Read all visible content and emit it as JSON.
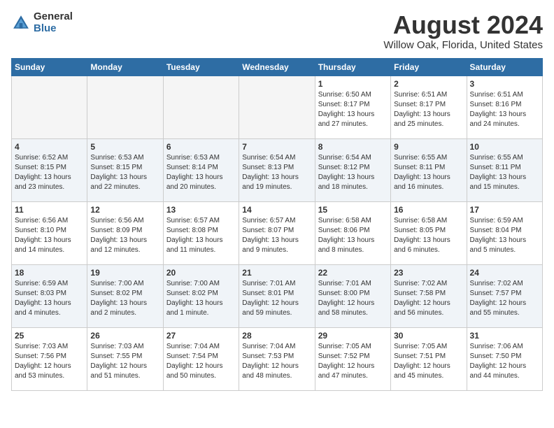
{
  "logo": {
    "general": "General",
    "blue": "Blue"
  },
  "title": "August 2024",
  "subtitle": "Willow Oak, Florida, United States",
  "headers": [
    "Sunday",
    "Monday",
    "Tuesday",
    "Wednesday",
    "Thursday",
    "Friday",
    "Saturday"
  ],
  "weeks": [
    [
      {
        "day": "",
        "info": ""
      },
      {
        "day": "",
        "info": ""
      },
      {
        "day": "",
        "info": ""
      },
      {
        "day": "",
        "info": ""
      },
      {
        "day": "1",
        "info": "Sunrise: 6:50 AM\nSunset: 8:17 PM\nDaylight: 13 hours\nand 27 minutes."
      },
      {
        "day": "2",
        "info": "Sunrise: 6:51 AM\nSunset: 8:17 PM\nDaylight: 13 hours\nand 25 minutes."
      },
      {
        "day": "3",
        "info": "Sunrise: 6:51 AM\nSunset: 8:16 PM\nDaylight: 13 hours\nand 24 minutes."
      }
    ],
    [
      {
        "day": "4",
        "info": "Sunrise: 6:52 AM\nSunset: 8:15 PM\nDaylight: 13 hours\nand 23 minutes."
      },
      {
        "day": "5",
        "info": "Sunrise: 6:53 AM\nSunset: 8:15 PM\nDaylight: 13 hours\nand 22 minutes."
      },
      {
        "day": "6",
        "info": "Sunrise: 6:53 AM\nSunset: 8:14 PM\nDaylight: 13 hours\nand 20 minutes."
      },
      {
        "day": "7",
        "info": "Sunrise: 6:54 AM\nSunset: 8:13 PM\nDaylight: 13 hours\nand 19 minutes."
      },
      {
        "day": "8",
        "info": "Sunrise: 6:54 AM\nSunset: 8:12 PM\nDaylight: 13 hours\nand 18 minutes."
      },
      {
        "day": "9",
        "info": "Sunrise: 6:55 AM\nSunset: 8:11 PM\nDaylight: 13 hours\nand 16 minutes."
      },
      {
        "day": "10",
        "info": "Sunrise: 6:55 AM\nSunset: 8:11 PM\nDaylight: 13 hours\nand 15 minutes."
      }
    ],
    [
      {
        "day": "11",
        "info": "Sunrise: 6:56 AM\nSunset: 8:10 PM\nDaylight: 13 hours\nand 14 minutes."
      },
      {
        "day": "12",
        "info": "Sunrise: 6:56 AM\nSunset: 8:09 PM\nDaylight: 13 hours\nand 12 minutes."
      },
      {
        "day": "13",
        "info": "Sunrise: 6:57 AM\nSunset: 8:08 PM\nDaylight: 13 hours\nand 11 minutes."
      },
      {
        "day": "14",
        "info": "Sunrise: 6:57 AM\nSunset: 8:07 PM\nDaylight: 13 hours\nand 9 minutes."
      },
      {
        "day": "15",
        "info": "Sunrise: 6:58 AM\nSunset: 8:06 PM\nDaylight: 13 hours\nand 8 minutes."
      },
      {
        "day": "16",
        "info": "Sunrise: 6:58 AM\nSunset: 8:05 PM\nDaylight: 13 hours\nand 6 minutes."
      },
      {
        "day": "17",
        "info": "Sunrise: 6:59 AM\nSunset: 8:04 PM\nDaylight: 13 hours\nand 5 minutes."
      }
    ],
    [
      {
        "day": "18",
        "info": "Sunrise: 6:59 AM\nSunset: 8:03 PM\nDaylight: 13 hours\nand 4 minutes."
      },
      {
        "day": "19",
        "info": "Sunrise: 7:00 AM\nSunset: 8:02 PM\nDaylight: 13 hours\nand 2 minutes."
      },
      {
        "day": "20",
        "info": "Sunrise: 7:00 AM\nSunset: 8:02 PM\nDaylight: 13 hours\nand 1 minute."
      },
      {
        "day": "21",
        "info": "Sunrise: 7:01 AM\nSunset: 8:01 PM\nDaylight: 12 hours\nand 59 minutes."
      },
      {
        "day": "22",
        "info": "Sunrise: 7:01 AM\nSunset: 8:00 PM\nDaylight: 12 hours\nand 58 minutes."
      },
      {
        "day": "23",
        "info": "Sunrise: 7:02 AM\nSunset: 7:58 PM\nDaylight: 12 hours\nand 56 minutes."
      },
      {
        "day": "24",
        "info": "Sunrise: 7:02 AM\nSunset: 7:57 PM\nDaylight: 12 hours\nand 55 minutes."
      }
    ],
    [
      {
        "day": "25",
        "info": "Sunrise: 7:03 AM\nSunset: 7:56 PM\nDaylight: 12 hours\nand 53 minutes."
      },
      {
        "day": "26",
        "info": "Sunrise: 7:03 AM\nSunset: 7:55 PM\nDaylight: 12 hours\nand 51 minutes."
      },
      {
        "day": "27",
        "info": "Sunrise: 7:04 AM\nSunset: 7:54 PM\nDaylight: 12 hours\nand 50 minutes."
      },
      {
        "day": "28",
        "info": "Sunrise: 7:04 AM\nSunset: 7:53 PM\nDaylight: 12 hours\nand 48 minutes."
      },
      {
        "day": "29",
        "info": "Sunrise: 7:05 AM\nSunset: 7:52 PM\nDaylight: 12 hours\nand 47 minutes."
      },
      {
        "day": "30",
        "info": "Sunrise: 7:05 AM\nSunset: 7:51 PM\nDaylight: 12 hours\nand 45 minutes."
      },
      {
        "day": "31",
        "info": "Sunrise: 7:06 AM\nSunset: 7:50 PM\nDaylight: 12 hours\nand 44 minutes."
      }
    ]
  ]
}
